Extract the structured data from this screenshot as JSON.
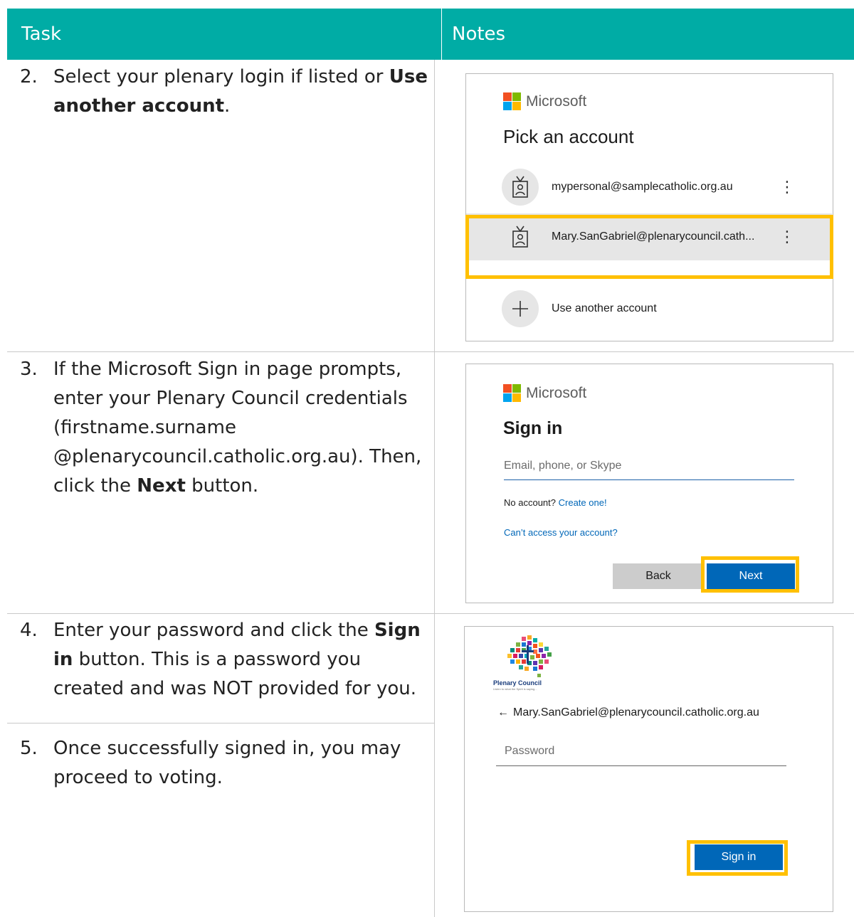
{
  "header": {
    "task": "Task",
    "notes": "Notes"
  },
  "steps": [
    {
      "num": "2.",
      "text_a": "Select your plenary login if listed or ",
      "bold": "Use another account",
      "text_b": "."
    },
    {
      "num": "3.",
      "text_a": "If the Microsoft Sign in page prompts, enter your Plenary Council credentials (firstname.surname @plenarycouncil.catholic.org.au). Then, click the ",
      "bold": "Next",
      "text_b": " button."
    },
    {
      "num": "4.",
      "text_a": "Enter your password and click the ",
      "bold": "Sign in",
      "text_b": " button.  This is a password you created and was NOT provided for you."
    },
    {
      "num": "5.",
      "text_a": "Once successfully signed in, you may proceed to voting."
    }
  ],
  "pick": {
    "brand": "Microsoft",
    "title": "Pick an account",
    "accounts": [
      "mypersonal@samplecatholic.org.au",
      "Mary.SanGabriel@plenarycouncil.cath..."
    ],
    "more": "⋮",
    "another": "Use another account"
  },
  "signin": {
    "brand": "Microsoft",
    "title": "Sign in",
    "placeholder": "Email, phone, or Skype",
    "no_account": "No account?",
    "create": "Create one!",
    "cant_access": "Can’t access your account?",
    "back": "Back",
    "next": "Next"
  },
  "password": {
    "logo_text": "Plenary Council",
    "logo_tagline": "Listen to what the Spirit is saying...",
    "back_arrow": "←",
    "email": "Mary.SanGabriel@plenarycouncil.catholic.org.au",
    "placeholder": "Password",
    "signin": "Sign in"
  },
  "colors": {
    "header": "#00aca5",
    "highlight": "#ffc000",
    "ms_blue": "#0067b8"
  }
}
